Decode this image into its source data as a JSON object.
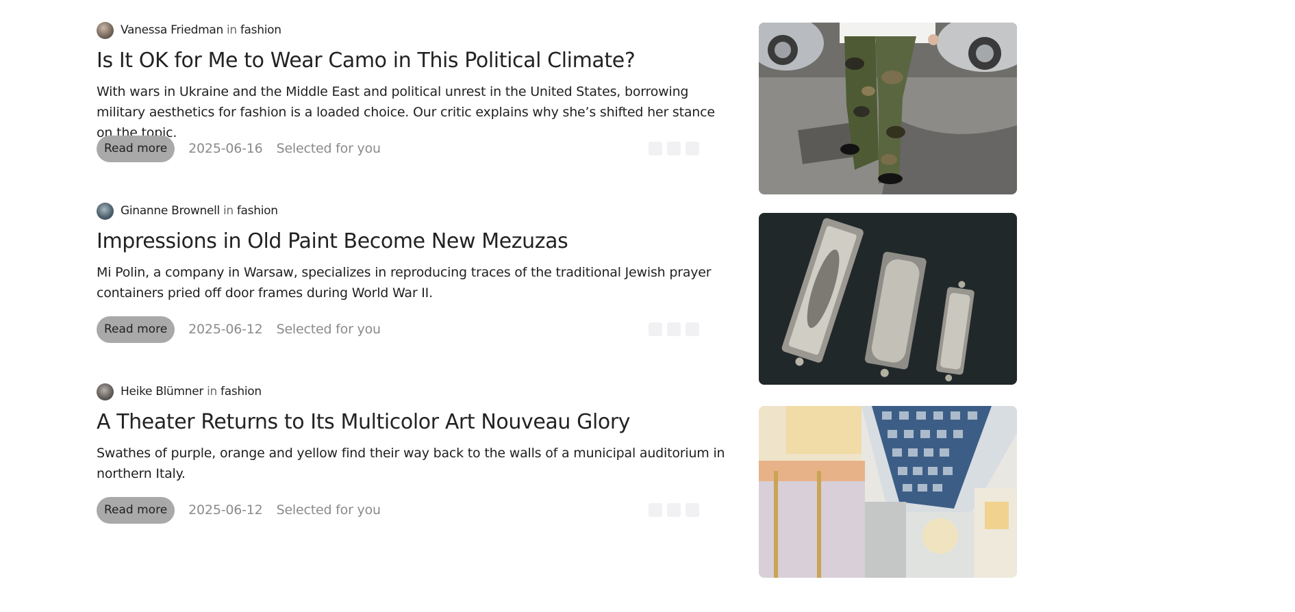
{
  "articles": [
    {
      "author": "Vanessa Friedman",
      "in_word": "in",
      "category": "fashion",
      "title": "Is It OK for Me to Wear Camo in This Political Climate?",
      "excerpt": "With wars in Ukraine and the Middle East and political unrest in the United States, borrowing military aesthetics for fashion is a loaded choice. Our critic explains why she’s shifted her stance on the topic.",
      "read_more": "Read more",
      "date": "2025-06-16",
      "tag": "Selected for you",
      "image_icon": "camo-pants-photo"
    },
    {
      "author": "Ginanne Brownell",
      "in_word": "in",
      "category": "fashion",
      "title": "Impressions in Old Paint Become New Mezuzas",
      "excerpt": "Mi Polin, a company in Warsaw, specializes in reproducing traces of the traditional Jewish prayer containers pried off door frames during World War II.",
      "read_more": "Read more",
      "date": "2025-06-12",
      "tag": "Selected for you",
      "image_icon": "mezuzas-photo"
    },
    {
      "author": "Heike Blümner",
      "in_word": "in",
      "category": "fashion",
      "title": "A Theater Returns to Its Multicolor Art Nouveau Glory",
      "excerpt": "Swathes of purple, orange and yellow find their way back to the walls of a municipal auditorium in northern Italy.",
      "read_more": "Read more",
      "date": "2025-06-12",
      "tag": "Selected for you",
      "image_icon": "theater-interior-photo"
    }
  ],
  "colors": {
    "read_more_bg": "#a9a9a9",
    "meta_text": "#8a8a8a",
    "title_text": "#222222",
    "action_bg": "#f1f1f4"
  }
}
